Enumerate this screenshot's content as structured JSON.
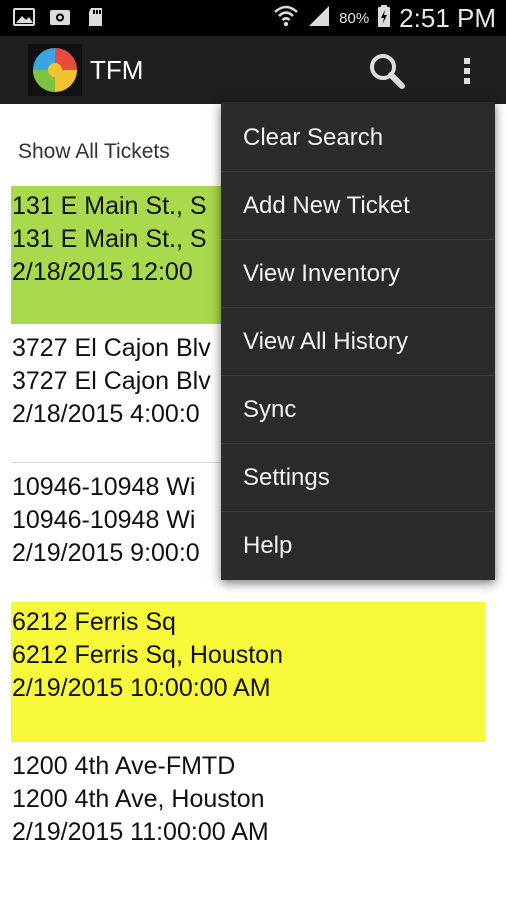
{
  "status_bar": {
    "battery_percent": "80%",
    "time": "2:51 PM",
    "left_icons": [
      "gallery-icon",
      "video-icon",
      "sd-card-icon"
    ]
  },
  "action_bar": {
    "title": "TFM",
    "icons": [
      "app-logo-icon",
      "search-icon",
      "overflow-menu-icon"
    ]
  },
  "filter": {
    "label": "Show All Tickets"
  },
  "tickets": [
    {
      "line1": "131 E Main St., S",
      "line2": "131 E Main St., S",
      "line3": "2/18/2015 12:00",
      "highlight": "#a9d94c"
    },
    {
      "line1": "3727 El Cajon Blv",
      "line2": "3727 El Cajon Blv",
      "line3": "2/18/2015 4:00:0",
      "highlight": ""
    },
    {
      "line1": "10946-10948 Wi",
      "line2": "10946-10948 Wi",
      "line3": "2/19/2015 9:00:0",
      "highlight": ""
    },
    {
      "line1": "6212 Ferris Sq",
      "line2": "6212 Ferris Sq, Houston",
      "line3": "2/19/2015 10:00:00 AM",
      "highlight": "#f8f83a"
    },
    {
      "line1": "1200 4th Ave-FMTD",
      "line2": "1200 4th Ave, Houston",
      "line3": "2/19/2015 11:00:00 AM",
      "highlight": ""
    }
  ],
  "menu": {
    "items": [
      "Clear Search",
      "Add New Ticket",
      "View Inventory",
      "View All History",
      "Sync",
      "Settings",
      "Help"
    ]
  },
  "colors": {
    "action_bar": "#1f1f1f",
    "menu_bg": "#2b2b2b",
    "ticket_green": "#a9d94c",
    "ticket_yellow": "#f8f83a"
  }
}
